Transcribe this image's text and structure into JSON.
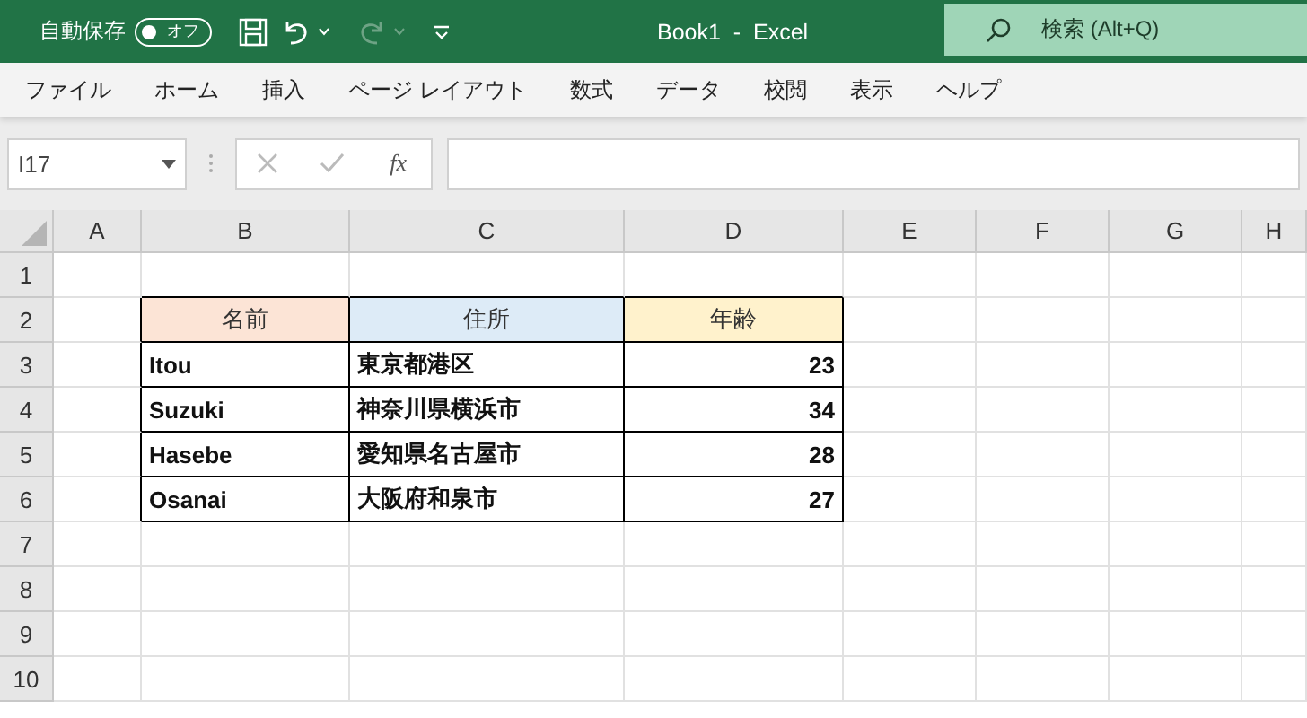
{
  "title_bar": {
    "autosave_label": "自動保存",
    "autosave_toggle": {
      "label": "オフ",
      "on": false
    },
    "title": "Book1  -  Excel",
    "search": {
      "placeholder": "検索 (Alt+Q)"
    }
  },
  "menu": [
    {
      "label": "ファイル",
      "selected": false
    },
    {
      "label": "ホーム",
      "selected": false
    },
    {
      "label": "挿入",
      "selected": false
    },
    {
      "label": "ページ レイアウト",
      "selected": false
    },
    {
      "label": "数式",
      "selected": false
    },
    {
      "label": "データ",
      "selected": false
    },
    {
      "label": "校閲",
      "selected": false
    },
    {
      "label": "表示",
      "selected": false
    },
    {
      "label": "ヘルプ",
      "selected": false
    }
  ],
  "formula_bar": {
    "name_box": "I17",
    "function_label": "fx"
  },
  "sheet": {
    "columns": [
      "A",
      "B",
      "C",
      "D",
      "E",
      "F",
      "G",
      "H"
    ],
    "row_numbers": [
      "1",
      "2",
      "3",
      "4",
      "5",
      "6",
      "7",
      "8",
      "9",
      "10"
    ],
    "table": {
      "header": [
        {
          "text": "名前",
          "color": "#fce4d6"
        },
        {
          "text": "住所",
          "color": "#ddebf7"
        },
        {
          "text": "年齢",
          "color": "#fff2cc"
        }
      ],
      "rows": [
        {
          "name": "Itou",
          "address": "東京都港区",
          "age": "23"
        },
        {
          "name": "Suzuki",
          "address": "神奈川県横浜市",
          "age": "34"
        },
        {
          "name": "Hasebe",
          "address": "愛知県名古屋市",
          "age": "28"
        },
        {
          "name": "Osanai",
          "address": "大阪府和泉市",
          "age": "27"
        }
      ]
    }
  }
}
